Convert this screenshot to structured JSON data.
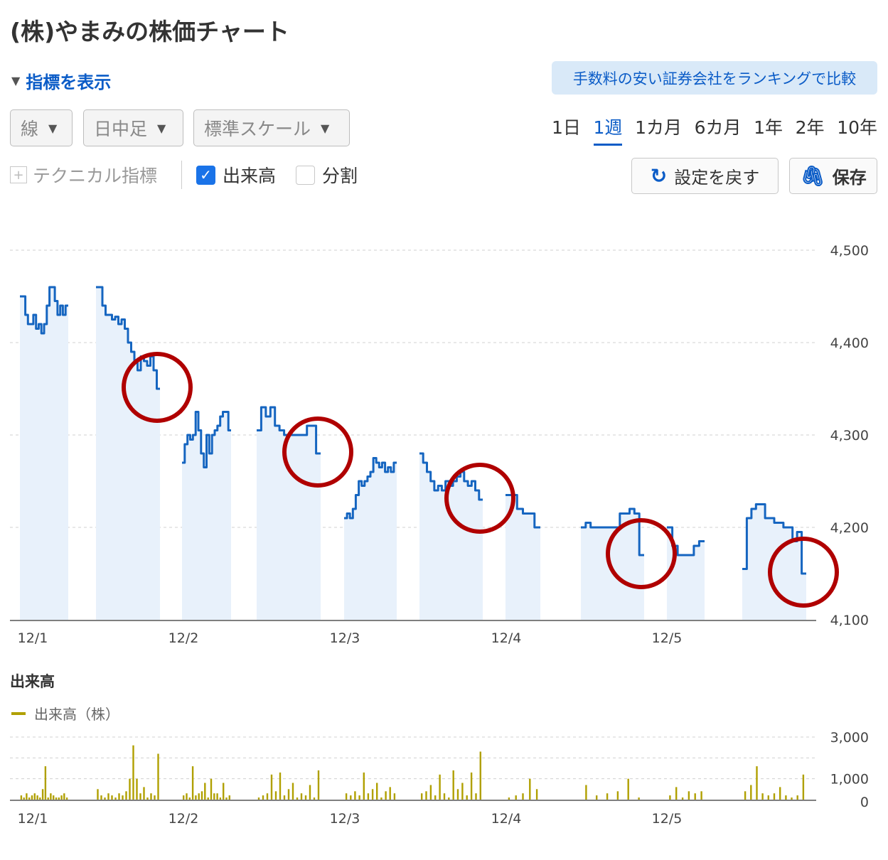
{
  "header": {
    "title": "(株)やまみの株価チャート"
  },
  "indicator_toggle": {
    "label": "指標を表示",
    "icon": "triangle-down-icon"
  },
  "promo": {
    "label": "手数料の安い証券会社をランキングで比較"
  },
  "controls": {
    "chart_type": "線",
    "bar_type": "日中足",
    "scale": "標準スケール"
  },
  "periods": [
    {
      "label": "1日",
      "active": false
    },
    {
      "label": "1週",
      "active": true
    },
    {
      "label": "1カ月",
      "active": false
    },
    {
      "label": "6カ月",
      "active": false
    },
    {
      "label": "1年",
      "active": false
    },
    {
      "label": "2年",
      "active": false
    },
    {
      "label": "10年",
      "active": false
    }
  ],
  "options": {
    "technical": "テクニカル指標",
    "volume": {
      "label": "出来高",
      "checked": true
    },
    "split": {
      "label": "分割",
      "checked": false
    }
  },
  "buttons": {
    "reset": "設定を戻す",
    "save": "保存"
  },
  "colors": {
    "price": "#1565c0",
    "price_fill": "#e8f1fb",
    "volume": "#b0a000",
    "highlight": "#b00000"
  },
  "chart_data": [
    {
      "type": "line",
      "title": "",
      "x_ticks": [
        "12/1",
        "12/2",
        "12/3",
        "12/4",
        "12/5"
      ],
      "y_ticks": [
        "4,500",
        "4,400",
        "4,300",
        "4,200",
        "4,100"
      ],
      "ylim": [
        4100,
        4500
      ],
      "grid": true,
      "segments": [
        {
          "day": "12/1",
          "session": "am",
          "values": [
            4450,
            4450,
            4430,
            4420,
            4420,
            4430,
            4415,
            4420,
            4410,
            4420,
            4440,
            4460,
            4460,
            4445,
            4430,
            4440,
            4430,
            4440
          ]
        },
        {
          "day": "12/1",
          "session": "pm",
          "values": [
            4460,
            4460,
            4440,
            4430,
            4430,
            4425,
            4428,
            4420,
            4425,
            4415,
            4400,
            4390,
            4380,
            4370,
            4385,
            4380,
            4375,
            4385,
            4370,
            4350
          ]
        },
        {
          "day": "12/2",
          "session": "am",
          "values": [
            4270,
            4290,
            4300,
            4295,
            4300,
            4325,
            4305,
            4280,
            4265,
            4300,
            4280,
            4300,
            4305,
            4310,
            4320,
            4325,
            4325,
            4305
          ]
        },
        {
          "day": "12/2",
          "session": "pm",
          "values": [
            4305,
            4330,
            4320,
            4330,
            4310,
            4305,
            4300,
            4300,
            4300,
            4300,
            4300,
            4310,
            4310,
            4280
          ]
        },
        {
          "day": "12/3",
          "session": "am",
          "values": [
            4210,
            4215,
            4210,
            4220,
            4235,
            4250,
            4245,
            4250,
            4255,
            4260,
            4275,
            4270,
            4265,
            4270,
            4260,
            4265,
            4260,
            4270
          ]
        },
        {
          "day": "12/3",
          "session": "pm",
          "values": [
            4280,
            4270,
            4260,
            4250,
            4240,
            4245,
            4240,
            4250,
            4245,
            4250,
            4255,
            4260,
            4250,
            4245,
            4250,
            4240,
            4230
          ]
        },
        {
          "day": "12/4",
          "session": "am",
          "values": [
            4235,
            4235,
            4220,
            4215,
            4215,
            4200
          ]
        },
        {
          "day": "12/4",
          "session": "pm",
          "values": [
            4200,
            4205,
            4200,
            4200,
            4200,
            4200,
            4200,
            4200,
            4215,
            4215,
            4220,
            4215,
            4170
          ]
        },
        {
          "day": "12/5",
          "session": "am",
          "values": [
            4200,
            4180,
            4170,
            4170,
            4170,
            4180,
            4185
          ]
        },
        {
          "day": "12/5",
          "session": "pm",
          "values": [
            4155,
            4210,
            4220,
            4225,
            4225,
            4210,
            4210,
            4205,
            4205,
            4200,
            4200,
            4185,
            4195,
            4150
          ]
        }
      ],
      "annotations": [
        {
          "type": "circle",
          "day": "12/1",
          "session": "pm",
          "position": "end"
        },
        {
          "type": "circle",
          "day": "12/2",
          "session": "pm",
          "position": "end"
        },
        {
          "type": "circle",
          "day": "12/3",
          "session": "pm",
          "position": "end"
        },
        {
          "type": "circle",
          "day": "12/4",
          "session": "pm",
          "position": "end"
        },
        {
          "type": "circle",
          "day": "12/5",
          "session": "pm",
          "position": "end"
        }
      ]
    },
    {
      "type": "bar",
      "title": "出来高",
      "legend": "出来高（株）",
      "x_ticks": [
        "12/1",
        "12/2",
        "12/3",
        "12/4",
        "12/5"
      ],
      "y_ticks": [
        "3,000",
        "1,000",
        "0"
      ],
      "ylim": [
        0,
        3000
      ],
      "bars_per_segment": [
        [
          200,
          100,
          300,
          100,
          200,
          300,
          200,
          100,
          500,
          1600,
          100,
          300,
          200,
          100,
          100,
          200,
          300,
          100
        ],
        [
          500,
          200,
          100,
          300,
          200,
          100,
          300,
          200,
          400,
          1000,
          2600,
          1000,
          300,
          600,
          100,
          300,
          200,
          2200
        ],
        [
          200,
          300,
          100,
          1600,
          200,
          300,
          400,
          800,
          100,
          1000,
          300,
          300,
          100,
          800,
          100,
          200
        ],
        [
          100,
          200,
          300,
          1200,
          400,
          1300,
          200,
          500,
          800,
          100,
          300,
          200,
          700,
          100,
          1400
        ],
        [
          300,
          200,
          400,
          200,
          1300,
          300,
          500,
          800,
          100,
          400,
          600,
          300
        ],
        [
          300,
          400,
          700,
          200,
          1200,
          300,
          100,
          1400,
          500,
          800,
          200,
          1300,
          300,
          2300
        ],
        [
          100,
          200,
          300,
          1000,
          500
        ],
        [
          700,
          200,
          300,
          400,
          1000,
          100
        ],
        [
          200,
          600,
          100,
          400,
          300,
          400
        ],
        [
          400,
          700,
          1600,
          300,
          200,
          300,
          600,
          200,
          100,
          200,
          1200
        ]
      ]
    }
  ]
}
